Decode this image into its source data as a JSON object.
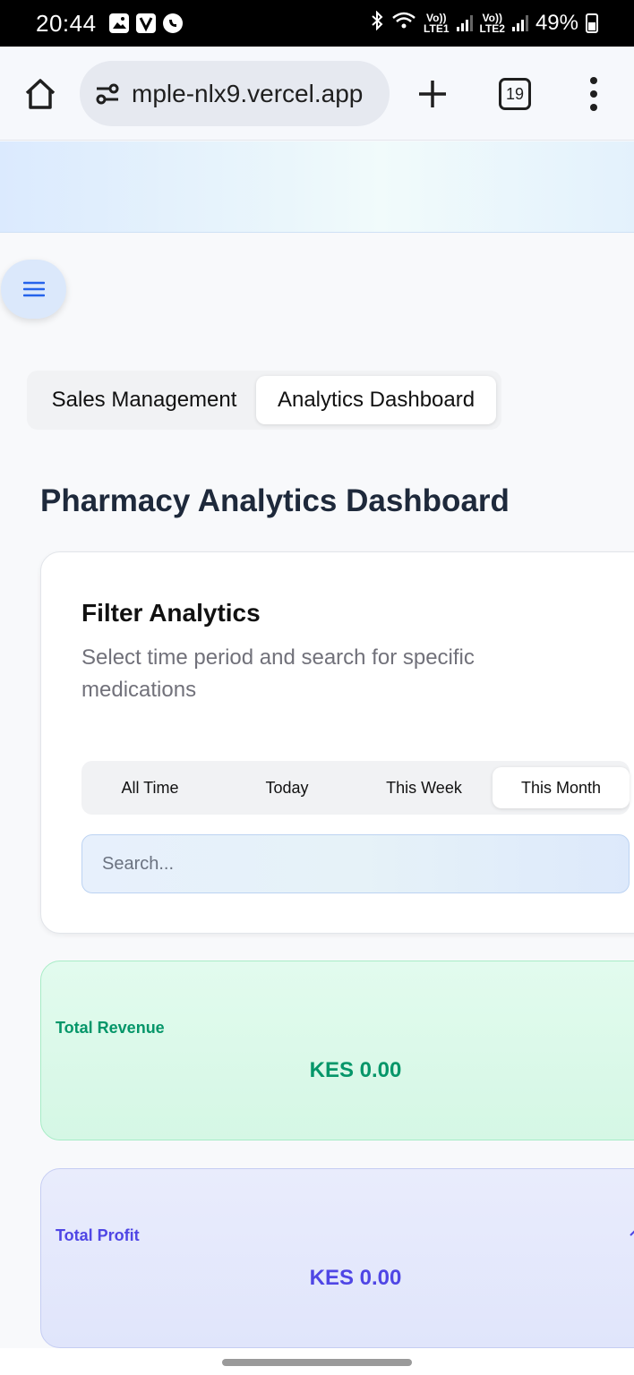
{
  "status_bar": {
    "time": "20:44",
    "lte1_top": "Vo))",
    "lte1_bottom": "LTE1",
    "lte2_top": "Vo))",
    "lte2_bottom": "LTE2",
    "battery": "49%",
    "icons": [
      "gallery-icon",
      "v-app-icon",
      "viber-icon",
      "bluetooth-icon",
      "wifi-icon",
      "signal-icon",
      "battery-icon"
    ]
  },
  "browser": {
    "url": "mple-nlx9.vercel.app",
    "tab_count": "19",
    "icons": [
      "home-icon",
      "site-settings-icon",
      "new-tab-icon",
      "tab-switcher-icon",
      "more-menu-icon"
    ]
  },
  "tabs": {
    "sales": "Sales Management",
    "analytics": "Analytics Dashboard",
    "active": "analytics"
  },
  "page_title": "Pharmacy Analytics Dashboard",
  "filter": {
    "title": "Filter Analytics",
    "description": "Select time period and search for specific medications",
    "periods": [
      "All Time",
      "Today",
      "This Week",
      "This Month"
    ],
    "active_period": "This Month",
    "search_placeholder": "Search..."
  },
  "stats": {
    "revenue": {
      "label": "Total Revenue",
      "value": "KES 0.00",
      "color": "#059669"
    },
    "profit": {
      "label": "Total Profit",
      "value": "KES 0.00",
      "color": "#4f46e5"
    }
  }
}
